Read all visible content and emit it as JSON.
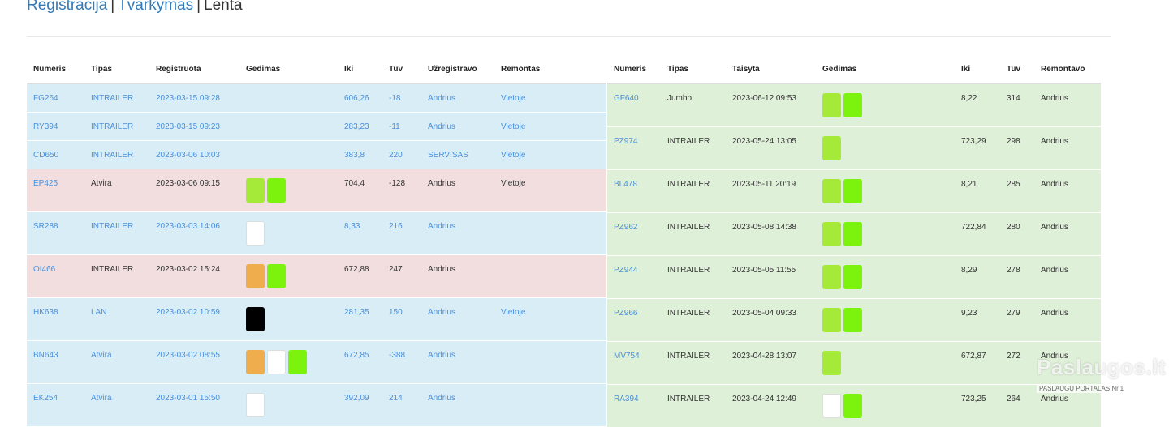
{
  "nav": {
    "registracija": "Registracija",
    "sep1": "|",
    "tvarkymas": "Tvarkymas",
    "sep2": "|",
    "lenta": "Lenta"
  },
  "colors": {
    "blue_row": "#d9edf7",
    "red_row": "#f2dede",
    "green_row": "#dff0d8",
    "link": "#4a90d9",
    "swatch_lime": "#a5ea38",
    "swatch_green": "#7cf30c",
    "swatch_orange": "#f0ad4e",
    "swatch_white": "#ffffff",
    "swatch_black": "#000000"
  },
  "left_table": {
    "headers": [
      "Numeris",
      "Tipas",
      "Registruota",
      "Gedimas",
      "Iki",
      "Tuv",
      "Užregistravo",
      "Remontas"
    ],
    "rows": [
      {
        "style": "blue",
        "numeris": "FG264",
        "tipas": "INTRAILER",
        "registruota": "2023-03-15 09:28",
        "gedimas": [],
        "iki": "606,26",
        "tuv": "-18",
        "uzregistravo": "Andrius",
        "remontas": "Vietoje"
      },
      {
        "style": "blue",
        "numeris": "RY394",
        "tipas": "INTRAILER",
        "registruota": "2023-03-15 09:23",
        "gedimas": [],
        "iki": "283,23",
        "tuv": "-11",
        "uzregistravo": "Andrius",
        "remontas": "Vietoje"
      },
      {
        "style": "blue",
        "numeris": "CD650",
        "tipas": "INTRAILER",
        "registruota": "2023-03-06 10:03",
        "gedimas": [],
        "iki": "383,8",
        "tuv": "220",
        "uzregistravo": "SERVISAS",
        "remontas": "Vietoje"
      },
      {
        "style": "red",
        "numeris": "EP425",
        "tipas": "Atvira",
        "registruota": "2023-03-06 09:15",
        "gedimas": [
          "lime",
          "green"
        ],
        "iki": "704,4",
        "tuv": "-128",
        "uzregistravo": "Andrius",
        "remontas": "Vietoje"
      },
      {
        "style": "blue",
        "numeris": "SR288",
        "tipas": "INTRAILER",
        "registruota": "2023-03-03 14:06",
        "gedimas": [
          "white"
        ],
        "iki": "8,33",
        "tuv": "216",
        "uzregistravo": "Andrius",
        "remontas": ""
      },
      {
        "style": "red",
        "numeris": "OI466",
        "tipas": "INTRAILER",
        "registruota": "2023-03-02 15:24",
        "gedimas": [
          "orange",
          "green"
        ],
        "iki": "672,88",
        "tuv": "247",
        "uzregistravo": "Andrius",
        "remontas": ""
      },
      {
        "style": "blue",
        "numeris": "HK638",
        "tipas": "LAN",
        "registruota": "2023-03-02 10:59",
        "gedimas": [
          "black"
        ],
        "iki": "281,35",
        "tuv": "150",
        "uzregistravo": "Andrius",
        "remontas": "Vietoje"
      },
      {
        "style": "blue",
        "numeris": "BN643",
        "tipas": "Atvira",
        "registruota": "2023-03-02 08:55",
        "gedimas": [
          "orange",
          "white",
          "green"
        ],
        "iki": "672,85",
        "tuv": "-388",
        "uzregistravo": "Andrius",
        "remontas": ""
      },
      {
        "style": "blue",
        "numeris": "EK254",
        "tipas": "Atvira",
        "registruota": "2023-03-01 15:50",
        "gedimas": [
          "white"
        ],
        "iki": "392,09",
        "tuv": "214",
        "uzregistravo": "Andrius",
        "remontas": ""
      }
    ]
  },
  "right_table": {
    "headers": [
      "Numeris",
      "Tipas",
      "Taisyta",
      "Gedimas",
      "Iki",
      "Tuv",
      "Remontavo"
    ],
    "rows": [
      {
        "numeris": "GF640",
        "tipas": "Jumbo",
        "taisyta": "2023-06-12 09:53",
        "gedimas": [
          "lime",
          "green"
        ],
        "iki": "8,22",
        "tuv": "314",
        "remontavo": "Andrius"
      },
      {
        "numeris": "PZ974",
        "tipas": "INTRAILER",
        "taisyta": "2023-05-24 13:05",
        "gedimas": [
          "lime"
        ],
        "iki": "723,29",
        "tuv": "298",
        "remontavo": "Andrius"
      },
      {
        "numeris": "BL478",
        "tipas": "INTRAILER",
        "taisyta": "2023-05-11 20:19",
        "gedimas": [
          "lime",
          "green"
        ],
        "iki": "8,21",
        "tuv": "285",
        "remontavo": "Andrius"
      },
      {
        "numeris": "PZ962",
        "tipas": "INTRAILER",
        "taisyta": "2023-05-08 14:38",
        "gedimas": [
          "lime",
          "green"
        ],
        "iki": "722,84",
        "tuv": "280",
        "remontavo": "Andrius"
      },
      {
        "numeris": "PZ944",
        "tipas": "INTRAILER",
        "taisyta": "2023-05-05 11:55",
        "gedimas": [
          "lime",
          "green"
        ],
        "iki": "8,29",
        "tuv": "278",
        "remontavo": "Andrius"
      },
      {
        "numeris": "PZ966",
        "tipas": "INTRAILER",
        "taisyta": "2023-05-04 09:33",
        "gedimas": [
          "lime",
          "green"
        ],
        "iki": "9,23",
        "tuv": "279",
        "remontavo": "Andrius"
      },
      {
        "numeris": "MV754",
        "tipas": "INTRAILER",
        "taisyta": "2023-04-28 13:07",
        "gedimas": [
          "lime"
        ],
        "iki": "672,87",
        "tuv": "272",
        "remontavo": "Andrius"
      },
      {
        "numeris": "RA394",
        "tipas": "INTRAILER",
        "taisyta": "2023-04-24 12:49",
        "gedimas": [
          "white",
          "green"
        ],
        "iki": "723,25",
        "tuv": "264",
        "remontavo": "Andrius"
      }
    ]
  },
  "watermark": {
    "brand": "Paslaugos.lt",
    "tagline": "PASLAUGŲ PORTALAS Nr.1"
  }
}
